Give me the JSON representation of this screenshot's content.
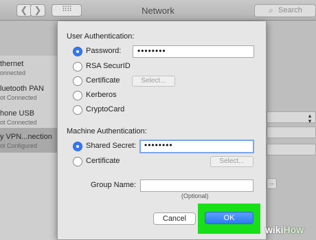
{
  "window": {
    "title": "Network",
    "back_glyph": "❮",
    "forward_glyph": "❯",
    "grid_glyph": "⠿⠿",
    "search_placeholder": "Search"
  },
  "network_list": [
    {
      "name": "thernet",
      "status": "onnected"
    },
    {
      "name": "luetooth PAN",
      "status": "ot Connected"
    },
    {
      "name": "hone USB",
      "status": "ot Connected"
    },
    {
      "name": "y VPN...nection",
      "status": "ot Configured"
    }
  ],
  "dialog": {
    "user_auth_label": "User Authentication:",
    "user_options": [
      {
        "label": "Password:",
        "selected": true
      },
      {
        "label": "RSA SecurID",
        "selected": false
      },
      {
        "label": "Certificate",
        "selected": false
      },
      {
        "label": "Kerberos",
        "selected": false
      },
      {
        "label": "CryptoCard",
        "selected": false
      }
    ],
    "password_value": "••••••••",
    "user_certificate_select": "Select...",
    "machine_auth_label": "Machine Authentication:",
    "machine_options": [
      {
        "label": "Shared Secret:",
        "selected": true
      },
      {
        "label": "Certificate",
        "selected": false
      }
    ],
    "shared_secret_value": "••••••••",
    "machine_certificate_select": "Select...",
    "group_name_label": "Group Name:",
    "group_name_value": "",
    "group_name_hint": "(Optional)",
    "cancel_label": "Cancel",
    "ok_label": "OK"
  },
  "watermark": {
    "wiki": "wiki",
    "how": "How"
  },
  "colors": {
    "accent": "#3478f6",
    "highlight": "#18e018"
  }
}
